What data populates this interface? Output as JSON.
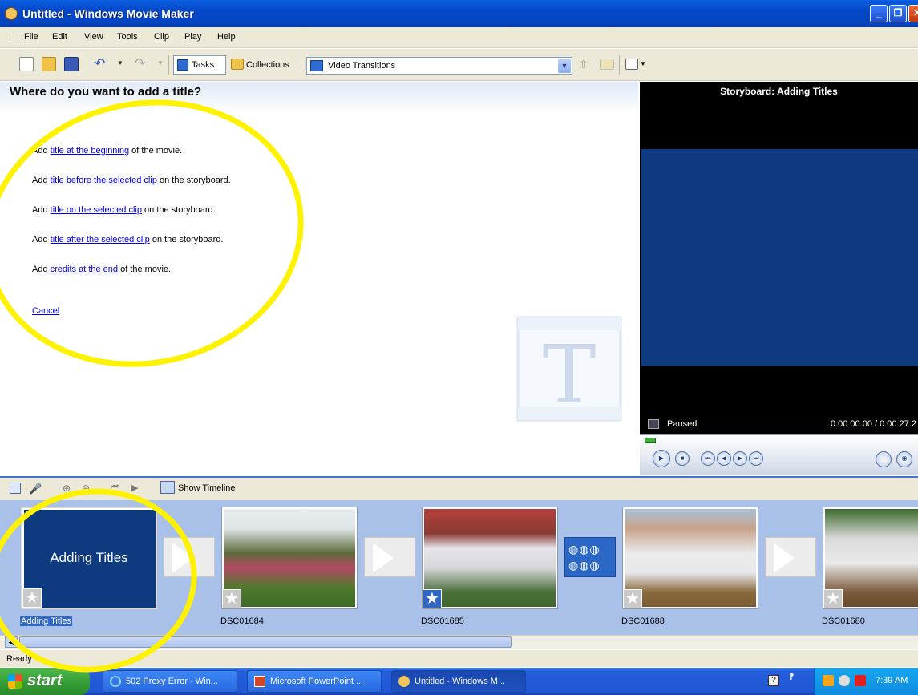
{
  "window": {
    "title": "Untitled - Windows Movie Maker"
  },
  "menu": [
    "File",
    "Edit",
    "View",
    "Tools",
    "Clip",
    "Play",
    "Help"
  ],
  "toolbar": {
    "tasks_label": "Tasks",
    "collections_label": "Collections",
    "dropdown_value": "Video Transitions"
  },
  "taskpane": {
    "heading": "Where do you want to add a title?",
    "options": [
      {
        "pre": "Add ",
        "link": "title at the beginning",
        "post": " of the movie."
      },
      {
        "pre": "Add ",
        "link": "title before the selected clip",
        "post": " on the storyboard."
      },
      {
        "pre": "Add ",
        "link": "title on the selected clip",
        "post": " on the storyboard."
      },
      {
        "pre": "Add ",
        "link": "title after the selected clip",
        "post": " on the storyboard."
      },
      {
        "pre": "Add ",
        "link": "credits at the end",
        "post": " of the movie."
      }
    ],
    "cancel": "Cancel"
  },
  "preview": {
    "title": "Storyboard: Adding Titles",
    "state": "Paused",
    "time": "0:00:00.00 / 0:00:27.2"
  },
  "storyboard": {
    "show_timeline": "Show Timeline",
    "clips": [
      {
        "label": "Adding Titles",
        "thumb_text": "Adding Titles"
      },
      {
        "label": "DSC01684"
      },
      {
        "label": "DSC01685"
      },
      {
        "label": "DSC01688"
      },
      {
        "label": "DSC01680"
      }
    ]
  },
  "status": "Ready",
  "taskbar": {
    "start": "start",
    "tasks": [
      "502 Proxy Error - Win...",
      "Microsoft PowerPoint ...",
      "Untitled - Windows M..."
    ],
    "clock": "7:39 AM"
  },
  "colors": {
    "title_bg": "#0845c8",
    "preview_screen": "#0e3a80",
    "storyboard_bg": "#a9c0e8",
    "highlight_circle": "#fff200"
  }
}
